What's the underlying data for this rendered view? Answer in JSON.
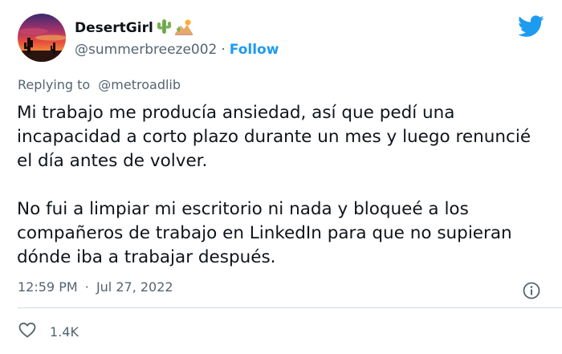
{
  "author": {
    "display_name": "DesertGirl",
    "handle": "@summerbreeze002",
    "follow_label": "Follow",
    "name_emojis": [
      "cactus-emoji",
      "desert-emoji"
    ]
  },
  "reply": {
    "prefix": "Replying to",
    "mention": "@metroadlib"
  },
  "body": {
    "paragraph_1": "Mi trabajo me producía ansiedad, así que pedí una incapacidad a corto plazo durante un mes y luego renuncié el día antes de volver.",
    "paragraph_2": "No fui a limpiar mi escritorio ni nada y bloqueé a los compañeros de trabajo en LinkedIn para que no supieran dónde iba a trabajar después."
  },
  "meta": {
    "time": "12:59 PM",
    "separator": "·",
    "date": "Jul 27, 2022"
  },
  "engagement": {
    "likes": "1.4K"
  },
  "colors": {
    "accent": "#1d9bf0",
    "text": "#0f1419",
    "secondary_text": "#536471",
    "divider": "#cfd9de"
  },
  "icons": [
    "twitter-bird-icon",
    "info-icon",
    "heart-icon"
  ]
}
